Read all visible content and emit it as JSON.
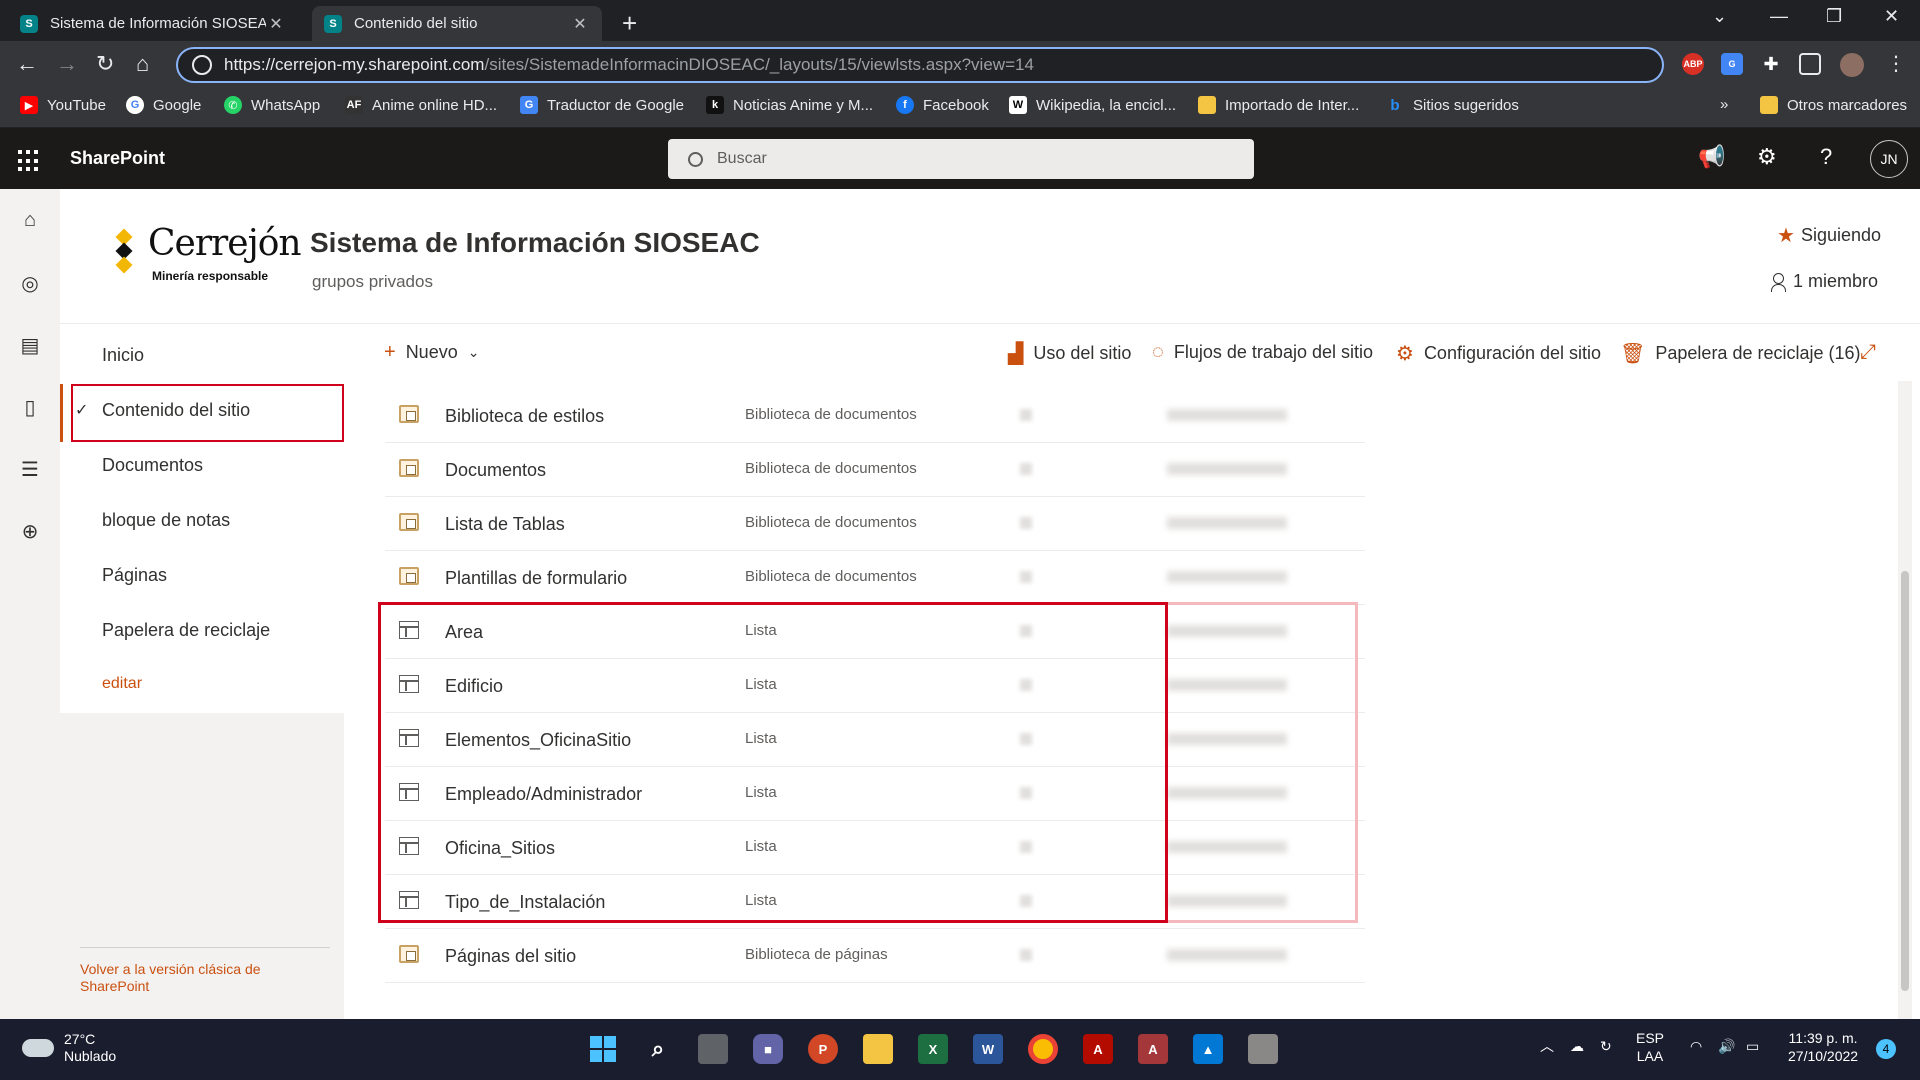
{
  "browser": {
    "tabs": [
      {
        "title": "Sistema de Información SIOSEAC",
        "active": false
      },
      {
        "title": "Contenido del sitio",
        "active": true
      }
    ],
    "url_prefix": "https://cerrejon-my.",
    "url_host": "sharepoint.com",
    "url_path": "/sites/SistemadeInformacinDIOSEAC/_layouts/15/viewlsts.aspx?view=14",
    "extensions": [
      "ABP"
    ],
    "bookmarks": [
      {
        "label": "YouTube",
        "icon": "youtube-icon",
        "color": "#ff0000"
      },
      {
        "label": "Google",
        "icon": "google-icon",
        "color": "#4285f4"
      },
      {
        "label": "WhatsApp",
        "icon": "whatsapp-icon",
        "color": "#25d366"
      },
      {
        "label": "Anime online HD...",
        "icon": "anime-icon",
        "color": "#333333"
      },
      {
        "label": "Traductor de Google",
        "icon": "translate-icon",
        "color": "#4285f4"
      },
      {
        "label": "Noticias Anime y M...",
        "icon": "news-icon",
        "color": "#111111"
      },
      {
        "label": "Facebook",
        "icon": "facebook-icon",
        "color": "#1877f2"
      },
      {
        "label": "Wikipedia, la encicl...",
        "icon": "wikipedia-icon",
        "color": "#ffffff"
      },
      {
        "label": "Importado de Inter...",
        "icon": "folder-icon",
        "color": "#f4c542"
      },
      {
        "label": "Sitios sugeridos",
        "icon": "bing-icon",
        "color": "#258ffa"
      }
    ],
    "more_bookmarks": "»",
    "other_bookmarks": "Otros marcadores"
  },
  "suite": {
    "brand": "SharePoint",
    "search_placeholder": "Buscar",
    "user_initials": "JN"
  },
  "site": {
    "logo_word": "Cerrejón",
    "logo_tag": "Minería responsable",
    "title": "Sistema de Información SIOSEAC",
    "subtitle": "grupos privados",
    "following": "Siguiendo",
    "members": "1 miembro"
  },
  "leftnav": {
    "items": [
      "Inicio",
      "Contenido del sitio",
      "Documentos",
      "bloque de notas",
      "Páginas",
      "Papelera de reciclaje",
      "editar"
    ],
    "selected": "Contenido del sitio",
    "classic_link": "Volver a la versión clásica de SharePoint"
  },
  "commands": {
    "new": "Nuevo",
    "usage": "Uso del sitio",
    "workflows": "Flujos de trabajo del sitio",
    "settings": "Configuración del sitio",
    "recycle": "Papelera de reciclaje (16)"
  },
  "contents": [
    {
      "name": "Biblioteca de estilos",
      "type": "Biblioteca de documentos",
      "icon": "library"
    },
    {
      "name": "Documentos",
      "type": "Biblioteca de documentos",
      "icon": "library"
    },
    {
      "name": "Lista de Tablas",
      "type": "Biblioteca de documentos",
      "icon": "library"
    },
    {
      "name": "Plantillas de formulario",
      "type": "Biblioteca de documentos",
      "icon": "library"
    },
    {
      "name": "Area",
      "type": "Lista",
      "icon": "list"
    },
    {
      "name": "Edificio",
      "type": "Lista",
      "icon": "list"
    },
    {
      "name": "Elementos_OficinaSitio",
      "type": "Lista",
      "icon": "list"
    },
    {
      "name": "Empleado/Administrador",
      "type": "Lista",
      "icon": "list"
    },
    {
      "name": "Oficina_Sitios",
      "type": "Lista",
      "icon": "list"
    },
    {
      "name": "Tipo_de_Instalación",
      "type": "Lista",
      "icon": "list"
    },
    {
      "name": "Páginas del sitio",
      "type": "Biblioteca de páginas",
      "icon": "library"
    }
  ],
  "taskbar": {
    "temperature": "27°C",
    "weather": "Nublado",
    "lang": "ESP",
    "layout": "LAA",
    "time": "11:39 p. m.",
    "date": "27/10/2022",
    "notifications": "4"
  }
}
